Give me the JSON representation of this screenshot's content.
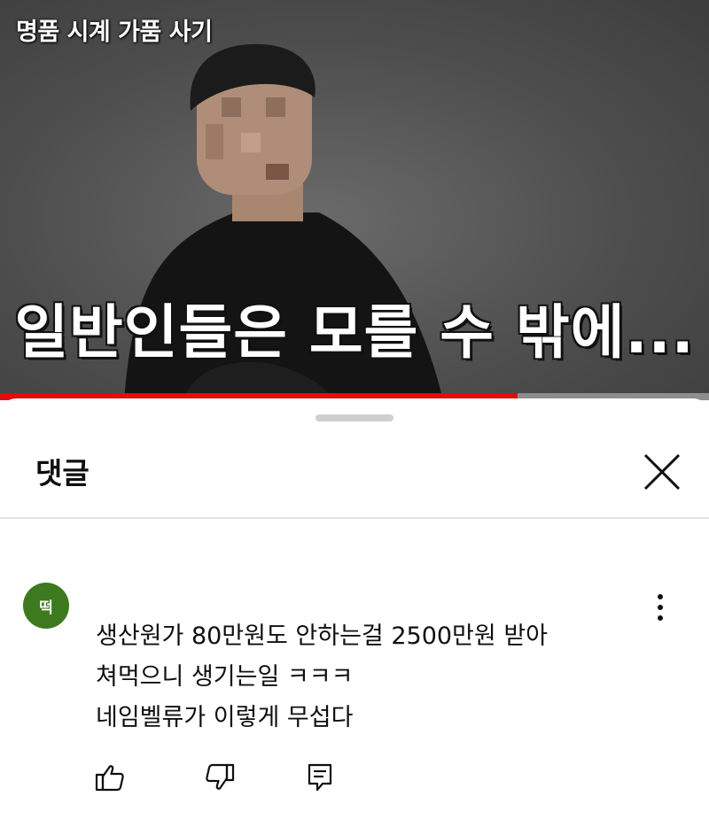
{
  "video": {
    "title": "명품 시계 가품 사기",
    "subtitle": "일반인들은 모를 수 밖에...",
    "progress_percent": 73
  },
  "comments_panel": {
    "title": "댓글",
    "close_icon": "close-icon",
    "comment": {
      "avatar_text": "떡",
      "avatar_color": "#3d7a1f",
      "lines": [
        "생산원가 80만원도 안하는걸 2500만원 받아",
        "쳐먹으니 생기는일 ㅋㅋㅋ",
        "네임벨류가 이렇게 무섭다"
      ],
      "actions": [
        "like-icon",
        "dislike-icon",
        "reply-icon"
      ],
      "menu_icon": "more-vertical-icon"
    }
  },
  "colors": {
    "progress": "#e30b0b",
    "progress_track": "#8d8d8d",
    "divider": "#e5e5e5"
  }
}
